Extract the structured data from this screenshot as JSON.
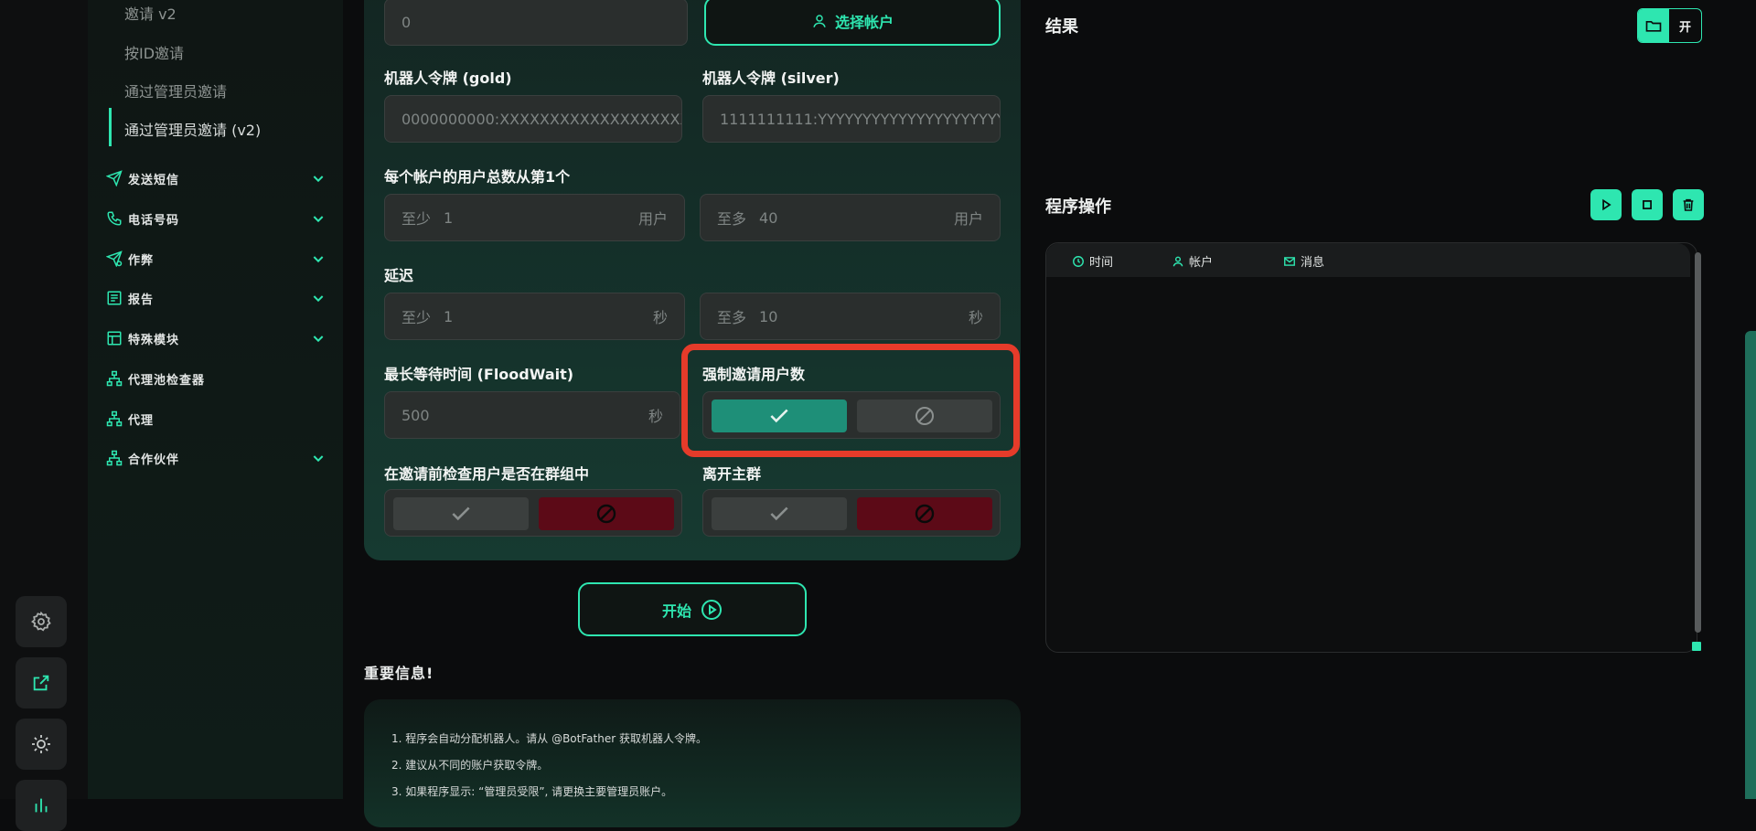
{
  "sidebar": {
    "sub_items": [
      "邀请 v2",
      "按ID邀请",
      "通过管理员邀请",
      "通过管理员邀请 (v2)"
    ],
    "nav": [
      {
        "label": "发送短信",
        "icon": "send-icon",
        "chevron": true
      },
      {
        "label": "电话号码",
        "icon": "phone-icon",
        "chevron": true
      },
      {
        "label": "作弊",
        "icon": "cheat-icon",
        "chevron": true
      },
      {
        "label": "报告",
        "icon": "report-icon",
        "chevron": true
      },
      {
        "label": "特殊模块",
        "icon": "module-icon",
        "chevron": true
      },
      {
        "label": "代理池检查器",
        "icon": "network-icon",
        "chevron": false
      },
      {
        "label": "代理",
        "icon": "network-icon",
        "chevron": false
      },
      {
        "label": "合作伙伴",
        "icon": "network-icon",
        "chevron": true
      }
    ]
  },
  "form": {
    "top_field_value": "0",
    "select_account_label": "选择帐户",
    "gold_label": "机器人令牌 (gold)",
    "gold_placeholder": "0000000000:XXXXXXXXXXXXXXXXXXXXXXXXXXXXX",
    "silver_label": "机器人令牌 (silver)",
    "silver_placeholder": "1111111111:YYYYYYYYYYYYYYYYYYYYYYYYYYYYY",
    "users_label": "每个帐户的用户总数从第1个",
    "users_min": {
      "prefix": "至少",
      "value": "1",
      "suffix": "用户"
    },
    "users_max": {
      "prefix": "至多",
      "value": "40",
      "suffix": "用户"
    },
    "delay_label": "延迟",
    "delay_min": {
      "prefix": "至少",
      "value": "1",
      "suffix": "秒"
    },
    "delay_max": {
      "prefix": "至多",
      "value": "10",
      "suffix": "秒"
    },
    "floodwait_label": "最长等待时间 (FloodWait)",
    "floodwait": {
      "value": "500",
      "suffix": "秒"
    },
    "force_label": "强制邀请用户数",
    "check_label": "在邀请前检查用户是否在群组中",
    "leave_label": "离开主群",
    "start_label": "开始"
  },
  "info": {
    "title": "重要信息!",
    "lines": [
      "1. 程序会自动分配机器人。请从 @BotFather 获取机器人令牌。",
      "2. 建议从不同的账户获取令牌。",
      "3. 如果程序显示: “管理员受限”, 请更换主要管理员账户。"
    ]
  },
  "results": {
    "title": "结果",
    "open_label": "开"
  },
  "operations": {
    "title": "程序操作",
    "columns": [
      "时间",
      "帐户",
      "消息"
    ]
  },
  "colors": {
    "accent": "#2ee6b0",
    "highlight": "#e53b2a",
    "danger": "#5c0a17"
  }
}
